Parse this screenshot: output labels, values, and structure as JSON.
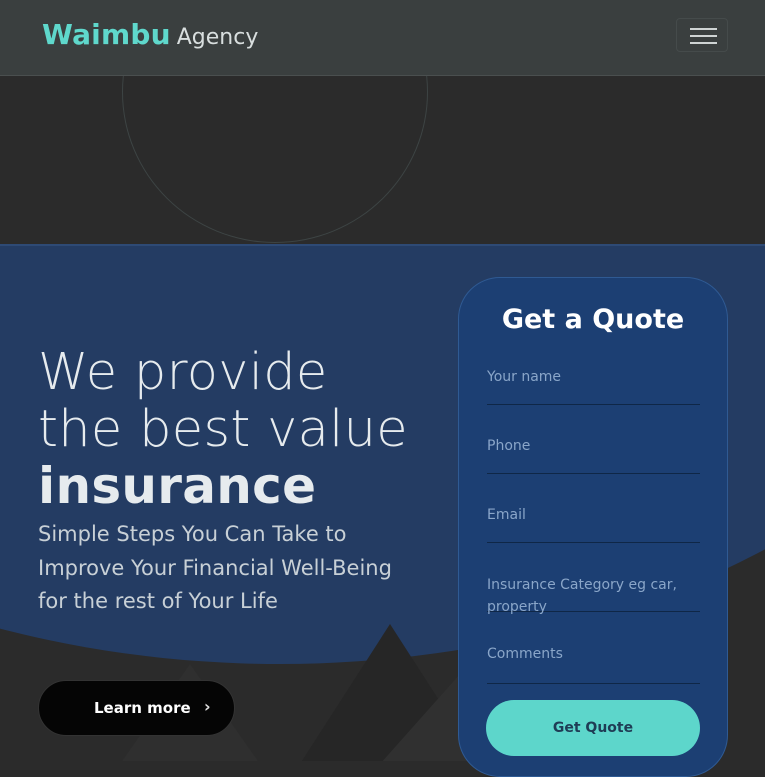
{
  "nav": {
    "brand_main": "Waimbu",
    "brand_sub": "Agency",
    "menu_icon": "hamburger-menu-icon"
  },
  "hero": {
    "headline_line1": "We provide",
    "headline_line2": "the best value",
    "headline_strong": "insurance",
    "subtitle": "Simple Steps You Can Take to Improve Your Financial Well-Being for the rest of Your Life",
    "cta_label": "Learn more",
    "cta_icon": "chevron-right-icon"
  },
  "quote_form": {
    "title": "Get a Quote",
    "fields": [
      {
        "placeholder": "Your name"
      },
      {
        "placeholder": "Phone"
      },
      {
        "placeholder": "Email"
      },
      {
        "placeholder": "Insurance Category eg car, property"
      },
      {
        "placeholder": "Comments"
      }
    ],
    "submit_label": "Get Quote"
  },
  "colors": {
    "accent": "#5fd8cc",
    "hero_blue": "#243c63",
    "card_blue": "#1c3f73",
    "dark_bg": "#2b2b2b",
    "navbar_bg": "#3a3f3f"
  }
}
